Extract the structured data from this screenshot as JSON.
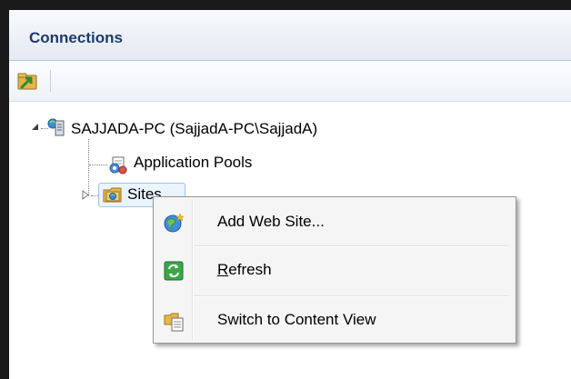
{
  "panel": {
    "title": "Connections"
  },
  "toolbar": {
    "icons": [
      "create-connection-icon"
    ]
  },
  "tree": {
    "root": {
      "label": "SAJJADA-PC (SajjadA-PC\\SajjadA)",
      "icon": "server-icon",
      "expanded": true
    },
    "children": [
      {
        "label": "Application Pools",
        "icon": "application-pools-icon"
      },
      {
        "label": "Sites",
        "icon": "sites-folder-icon",
        "selected": true,
        "expanded": false
      }
    ]
  },
  "context_menu": {
    "items": [
      {
        "label": "Add Web Site...",
        "icon": "add-web-site-icon"
      },
      {
        "label": "Refresh",
        "icon": "refresh-icon",
        "access_key": "R"
      },
      {
        "label": "Switch to Content View",
        "icon": "content-view-icon"
      }
    ]
  }
}
